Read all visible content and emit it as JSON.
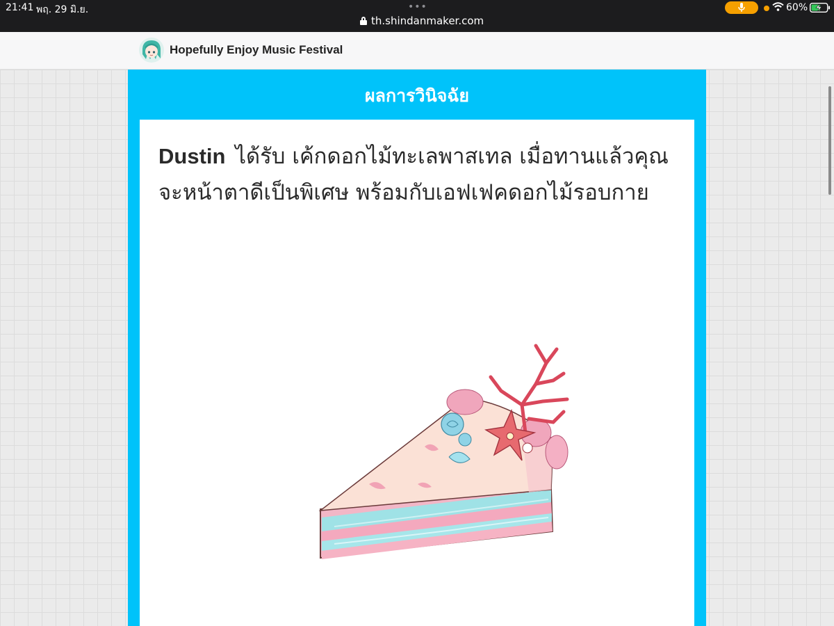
{
  "status_bar": {
    "time": "21:41",
    "date": "พฤ. 29 มิ.ย.",
    "more_dots": "•••",
    "url": "th.shindanmaker.com",
    "battery_percent": "60%",
    "battery_level": 0.6,
    "accent_color": "#f6a000"
  },
  "site": {
    "title": "Hopefully Enjoy Music Festival"
  },
  "result": {
    "heading": "ผลการวินิจฉัย",
    "name": "Dustin",
    "text": "ได้รับ เค้กดอกไม้ทะเลพาสเทล เมื่อทานแล้วคุณจะหน้าตาดีเป็นพิเศษ พร้อมกับเอฟเฟคดอกไม้รอบกาย"
  },
  "colors": {
    "panel": "#00c3fa",
    "status_bar": "#1c1c1e"
  }
}
